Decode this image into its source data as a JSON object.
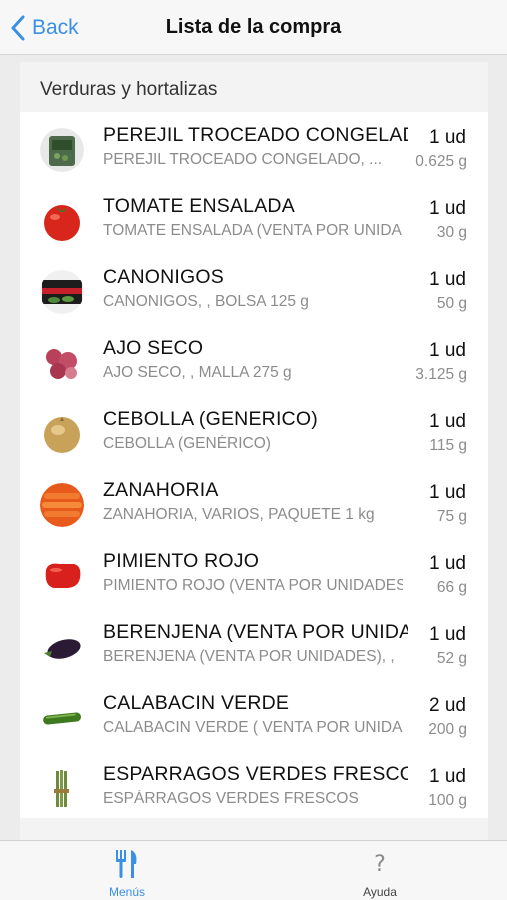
{
  "header": {
    "back_label": "Back",
    "title": "Lista de la compra"
  },
  "section": {
    "title": "Verduras y hortalizas"
  },
  "items": [
    {
      "name": "PEREJIL TROCEADO CONGELADO",
      "description": "PEREJIL TROCEADO CONGELADO, ...",
      "quantity": "1 ud",
      "weight": "0.625 g",
      "icon": "parsley-package-icon"
    },
    {
      "name": "TOMATE ENSALADA",
      "description": "TOMATE ENSALADA (VENTA POR UNIDADES)",
      "quantity": "1 ud",
      "weight": "30 g",
      "icon": "tomato-icon"
    },
    {
      "name": "CANONIGOS",
      "description": "CANONIGOS, , BOLSA 125 g",
      "quantity": "1 ud",
      "weight": "50 g",
      "icon": "lambs-lettuce-bag-icon"
    },
    {
      "name": "AJO SECO",
      "description": "AJO SECO, , MALLA 275 g",
      "quantity": "1 ud",
      "weight": "3.125 g",
      "icon": "garlic-icon"
    },
    {
      "name": "CEBOLLA (GENERICO)",
      "description": "CEBOLLA (GENÉRICO)",
      "quantity": "1 ud",
      "weight": "115 g",
      "icon": "onion-icon"
    },
    {
      "name": "ZANAHORIA",
      "description": "ZANAHORIA, VARIOS, PAQUETE 1 kg",
      "quantity": "1 ud",
      "weight": "75 g",
      "icon": "carrot-icon"
    },
    {
      "name": "PIMIENTO ROJO",
      "description": "PIMIENTO ROJO (VENTA POR UNIDADES)",
      "quantity": "1 ud",
      "weight": "66 g",
      "icon": "red-pepper-icon"
    },
    {
      "name": "BERENJENA (VENTA POR UNIDADES)",
      "description": "BERENJENA (VENTA POR UNIDADES), ,",
      "quantity": "1 ud",
      "weight": "52 g",
      "icon": "eggplant-icon"
    },
    {
      "name": "CALABACIN VERDE",
      "description": "CALABACIN VERDE ( VENTA POR UNIDADES)",
      "quantity": "2 ud",
      "weight": "200 g",
      "icon": "zucchini-icon"
    },
    {
      "name": "ESPARRAGOS VERDES FRESCOS",
      "description": "ESPÁRRAGOS VERDES FRESCOS",
      "quantity": "1 ud",
      "weight": "100 g",
      "icon": "asparagus-icon"
    }
  ],
  "tabbar": {
    "menus_label": "Menús",
    "ayuda_label": "Ayuda",
    "ayuda_glyph": "?"
  },
  "colors": {
    "accent": "#3a8fe6",
    "secondary_text": "#8c8c8c"
  }
}
